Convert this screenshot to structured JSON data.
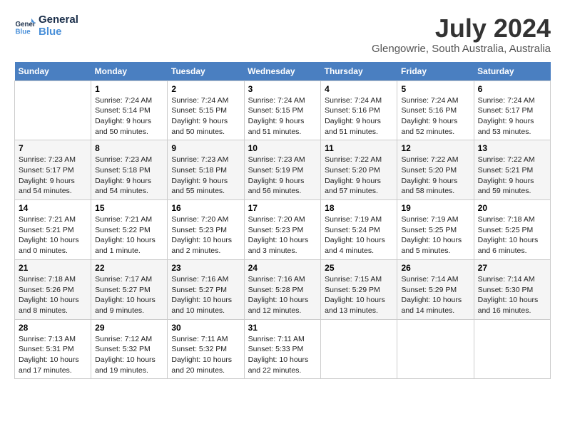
{
  "header": {
    "logo_line1": "General",
    "logo_line2": "Blue",
    "month": "July 2024",
    "location": "Glengowrie, South Australia, Australia"
  },
  "weekdays": [
    "Sunday",
    "Monday",
    "Tuesday",
    "Wednesday",
    "Thursday",
    "Friday",
    "Saturday"
  ],
  "weeks": [
    [
      {
        "day": "",
        "info": ""
      },
      {
        "day": "1",
        "info": "Sunrise: 7:24 AM\nSunset: 5:14 PM\nDaylight: 9 hours\nand 50 minutes."
      },
      {
        "day": "2",
        "info": "Sunrise: 7:24 AM\nSunset: 5:15 PM\nDaylight: 9 hours\nand 50 minutes."
      },
      {
        "day": "3",
        "info": "Sunrise: 7:24 AM\nSunset: 5:15 PM\nDaylight: 9 hours\nand 51 minutes."
      },
      {
        "day": "4",
        "info": "Sunrise: 7:24 AM\nSunset: 5:16 PM\nDaylight: 9 hours\nand 51 minutes."
      },
      {
        "day": "5",
        "info": "Sunrise: 7:24 AM\nSunset: 5:16 PM\nDaylight: 9 hours\nand 52 minutes."
      },
      {
        "day": "6",
        "info": "Sunrise: 7:24 AM\nSunset: 5:17 PM\nDaylight: 9 hours\nand 53 minutes."
      }
    ],
    [
      {
        "day": "7",
        "info": "Sunrise: 7:23 AM\nSunset: 5:17 PM\nDaylight: 9 hours\nand 54 minutes."
      },
      {
        "day": "8",
        "info": "Sunrise: 7:23 AM\nSunset: 5:18 PM\nDaylight: 9 hours\nand 54 minutes."
      },
      {
        "day": "9",
        "info": "Sunrise: 7:23 AM\nSunset: 5:18 PM\nDaylight: 9 hours\nand 55 minutes."
      },
      {
        "day": "10",
        "info": "Sunrise: 7:23 AM\nSunset: 5:19 PM\nDaylight: 9 hours\nand 56 minutes."
      },
      {
        "day": "11",
        "info": "Sunrise: 7:22 AM\nSunset: 5:20 PM\nDaylight: 9 hours\nand 57 minutes."
      },
      {
        "day": "12",
        "info": "Sunrise: 7:22 AM\nSunset: 5:20 PM\nDaylight: 9 hours\nand 58 minutes."
      },
      {
        "day": "13",
        "info": "Sunrise: 7:22 AM\nSunset: 5:21 PM\nDaylight: 9 hours\nand 59 minutes."
      }
    ],
    [
      {
        "day": "14",
        "info": "Sunrise: 7:21 AM\nSunset: 5:21 PM\nDaylight: 10 hours\nand 0 minutes."
      },
      {
        "day": "15",
        "info": "Sunrise: 7:21 AM\nSunset: 5:22 PM\nDaylight: 10 hours\nand 1 minute."
      },
      {
        "day": "16",
        "info": "Sunrise: 7:20 AM\nSunset: 5:23 PM\nDaylight: 10 hours\nand 2 minutes."
      },
      {
        "day": "17",
        "info": "Sunrise: 7:20 AM\nSunset: 5:23 PM\nDaylight: 10 hours\nand 3 minutes."
      },
      {
        "day": "18",
        "info": "Sunrise: 7:19 AM\nSunset: 5:24 PM\nDaylight: 10 hours\nand 4 minutes."
      },
      {
        "day": "19",
        "info": "Sunrise: 7:19 AM\nSunset: 5:25 PM\nDaylight: 10 hours\nand 5 minutes."
      },
      {
        "day": "20",
        "info": "Sunrise: 7:18 AM\nSunset: 5:25 PM\nDaylight: 10 hours\nand 6 minutes."
      }
    ],
    [
      {
        "day": "21",
        "info": "Sunrise: 7:18 AM\nSunset: 5:26 PM\nDaylight: 10 hours\nand 8 minutes."
      },
      {
        "day": "22",
        "info": "Sunrise: 7:17 AM\nSunset: 5:27 PM\nDaylight: 10 hours\nand 9 minutes."
      },
      {
        "day": "23",
        "info": "Sunrise: 7:16 AM\nSunset: 5:27 PM\nDaylight: 10 hours\nand 10 minutes."
      },
      {
        "day": "24",
        "info": "Sunrise: 7:16 AM\nSunset: 5:28 PM\nDaylight: 10 hours\nand 12 minutes."
      },
      {
        "day": "25",
        "info": "Sunrise: 7:15 AM\nSunset: 5:29 PM\nDaylight: 10 hours\nand 13 minutes."
      },
      {
        "day": "26",
        "info": "Sunrise: 7:14 AM\nSunset: 5:29 PM\nDaylight: 10 hours\nand 14 minutes."
      },
      {
        "day": "27",
        "info": "Sunrise: 7:14 AM\nSunset: 5:30 PM\nDaylight: 10 hours\nand 16 minutes."
      }
    ],
    [
      {
        "day": "28",
        "info": "Sunrise: 7:13 AM\nSunset: 5:31 PM\nDaylight: 10 hours\nand 17 minutes."
      },
      {
        "day": "29",
        "info": "Sunrise: 7:12 AM\nSunset: 5:32 PM\nDaylight: 10 hours\nand 19 minutes."
      },
      {
        "day": "30",
        "info": "Sunrise: 7:11 AM\nSunset: 5:32 PM\nDaylight: 10 hours\nand 20 minutes."
      },
      {
        "day": "31",
        "info": "Sunrise: 7:11 AM\nSunset: 5:33 PM\nDaylight: 10 hours\nand 22 minutes."
      },
      {
        "day": "",
        "info": ""
      },
      {
        "day": "",
        "info": ""
      },
      {
        "day": "",
        "info": ""
      }
    ]
  ]
}
